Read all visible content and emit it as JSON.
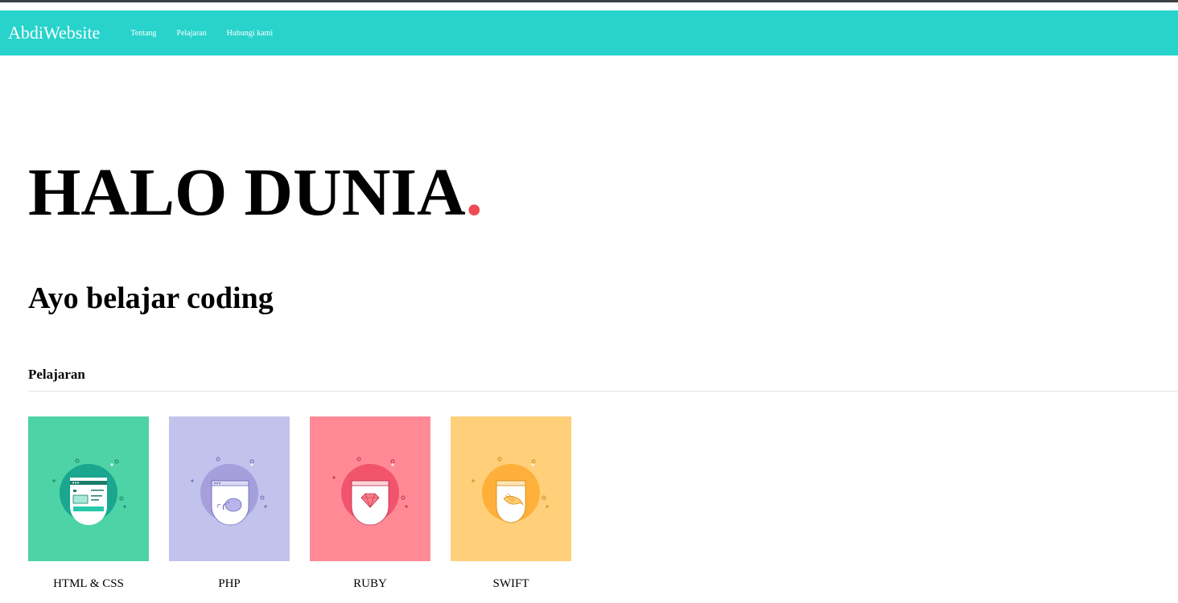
{
  "navbar": {
    "brand": "AbdiWebsite",
    "links": [
      "Tentang",
      "Pelajaran",
      "Hubungi kami"
    ],
    "background": "#27d3cb"
  },
  "hero": {
    "title": "HALO DUNIA",
    "dot": ".",
    "dot_color": "#ef4b54",
    "subtitle": "Ayo belajar coding"
  },
  "lessons": {
    "heading": "Pelajaran",
    "items": [
      {
        "label": "HTML & CSS",
        "icon": "html-css-icon",
        "bg": "#4dd3a5",
        "circle": "#1aa68f"
      },
      {
        "label": "PHP",
        "icon": "php-elephant-icon",
        "bg": "#c2c3ec",
        "circle": "#a59fdc"
      },
      {
        "label": "RUBY",
        "icon": "ruby-gem-icon",
        "bg": "#ff8a96",
        "circle": "#f2546d"
      },
      {
        "label": "SWIFT",
        "icon": "swift-bird-icon",
        "bg": "#ffcf7a",
        "circle": "#ffb03a"
      }
    ]
  }
}
